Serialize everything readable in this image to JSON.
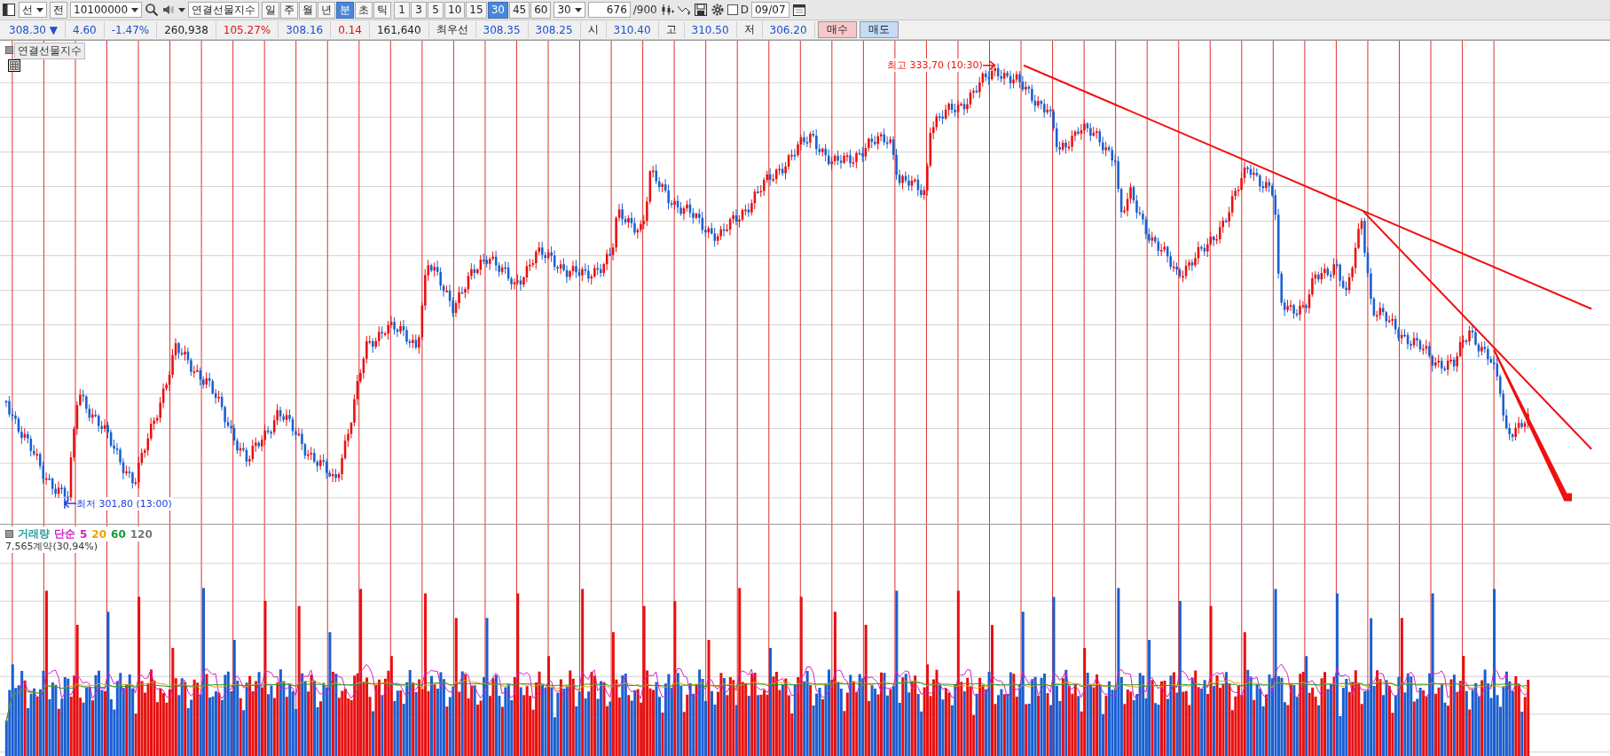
{
  "toolbar": {
    "market": "선",
    "prev": "전",
    "code": "10100000",
    "name": "연결선물지수",
    "periods": [
      {
        "label": "일",
        "selected": false
      },
      {
        "label": "주",
        "selected": false
      },
      {
        "label": "월",
        "selected": false
      },
      {
        "label": "년",
        "selected": false
      },
      {
        "label": "분",
        "selected": true
      },
      {
        "label": "초",
        "selected": false
      },
      {
        "label": "틱",
        "selected": false
      }
    ],
    "intervals": [
      {
        "label": "1",
        "selected": false
      },
      {
        "label": "3",
        "selected": false
      },
      {
        "label": "5",
        "selected": false
      },
      {
        "label": "10",
        "selected": false
      },
      {
        "label": "15",
        "selected": false
      },
      {
        "label": "30",
        "selected": true
      },
      {
        "label": "45",
        "selected": false
      },
      {
        "label": "60",
        "selected": false
      }
    ],
    "interval_value": "30",
    "count": "676",
    "count_max": "/900",
    "d_checkbox": {
      "label": "D",
      "checked": false
    },
    "date": "09/07"
  },
  "quote": {
    "items": [
      {
        "text": "308.30 ▼",
        "color": "#1a4fd0"
      },
      {
        "text": "4.60",
        "color": "#1a4fd0"
      },
      {
        "text": "-1.47%",
        "color": "#1a4fd0"
      },
      {
        "text": "260,938",
        "color": "#222222"
      },
      {
        "text": "105.27%",
        "color": "#e01010"
      },
      {
        "text": "308.16",
        "color": "#1a4fd0"
      },
      {
        "text": "0.14",
        "color": "#e01010"
      },
      {
        "text": "161,640",
        "color": "#222222"
      },
      {
        "text": "최우선"
      },
      {
        "text": "308.35",
        "color": "#1a4fd0"
      },
      {
        "text": "308.25",
        "color": "#1a4fd0"
      },
      {
        "text": "시"
      },
      {
        "text": "310.40",
        "color": "#1a4fd0"
      },
      {
        "text": "고",
        "color": "#222222"
      },
      {
        "text": "310.50",
        "color": "#1a4fd0"
      },
      {
        "text": "저"
      },
      {
        "text": "306.20",
        "color": "#1a4fd0"
      }
    ],
    "buttons": [
      {
        "label": "매수",
        "kind": "buy"
      },
      {
        "label": "매도",
        "kind": "sell"
      }
    ]
  },
  "chart": {
    "title": "연결선물지수",
    "high_label": "최고 333,70 (10:30)",
    "low_label": "최저 301,80 (13:00)"
  },
  "volume": {
    "legend": [
      {
        "text": "거래량",
        "color": "#2a9d9d"
      },
      {
        "text": "단순",
        "color": "#d21fc8"
      },
      {
        "text": "5",
        "color": "#d21fc8"
      },
      {
        "text": "20",
        "color": "#f0a000"
      },
      {
        "text": "60",
        "color": "#1a9a3a"
      },
      {
        "text": "120",
        "color": "#777777"
      }
    ],
    "summary": "7,565계약(30,94%)"
  }
}
